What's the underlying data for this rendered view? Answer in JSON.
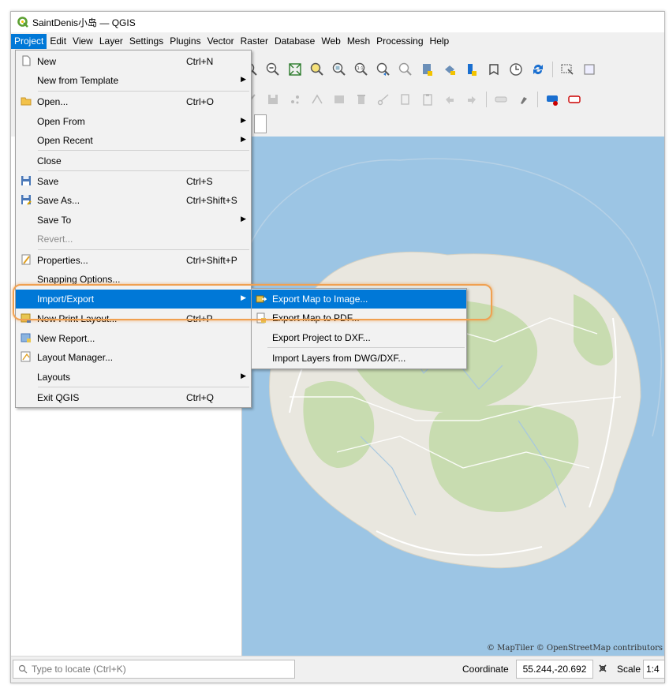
{
  "window": {
    "title": "SaintDenis小岛 — QGIS"
  },
  "menubar": [
    "Project",
    "Edit",
    "View",
    "Layer",
    "Settings",
    "Plugins",
    "Vector",
    "Raster",
    "Database",
    "Web",
    "Mesh",
    "Processing",
    "Help"
  ],
  "project_menu": {
    "new": {
      "label": "New",
      "shortcut": "Ctrl+N"
    },
    "new_from_template": {
      "label": "New from Template"
    },
    "open": {
      "label": "Open...",
      "shortcut": "Ctrl+O"
    },
    "open_from": {
      "label": "Open From"
    },
    "open_recent": {
      "label": "Open Recent"
    },
    "close": {
      "label": "Close"
    },
    "save": {
      "label": "Save",
      "shortcut": "Ctrl+S"
    },
    "save_as": {
      "label": "Save As...",
      "shortcut": "Ctrl+Shift+S"
    },
    "save_to": {
      "label": "Save To"
    },
    "revert": {
      "label": "Revert..."
    },
    "properties": {
      "label": "Properties...",
      "shortcut": "Ctrl+Shift+P"
    },
    "snapping_options": {
      "label": "Snapping Options..."
    },
    "import_export": {
      "label": "Import/Export"
    },
    "new_print_layout": {
      "label": "New Print Layout...",
      "shortcut": "Ctrl+P"
    },
    "new_report": {
      "label": "New Report..."
    },
    "layout_manager": {
      "label": "Layout Manager..."
    },
    "layouts": {
      "label": "Layouts"
    },
    "exit": {
      "label": "Exit QGIS",
      "shortcut": "Ctrl+Q"
    }
  },
  "import_export_submenu": {
    "export_image": "Export Map to Image...",
    "export_pdf": "Export Map to PDF...",
    "export_dxf": "Export Project to DXF...",
    "import_dwg": "Import Layers from DWG/DXF..."
  },
  "map": {
    "attribution": "© MapTiler  © OpenStreetMap contributors"
  },
  "status": {
    "locator_placeholder": "Type to locate (Ctrl+K)",
    "coordinate_label": "Coordinate",
    "coordinate_value": "55.244,-20.692",
    "scale_label": "Scale",
    "scale_value": "1:4"
  },
  "colors": {
    "accent": "#0078d7",
    "highlight_outline": "#f0a050",
    "sea": "#9cc5e4",
    "land": "#e9e7df",
    "forest": "#c8dcb0"
  },
  "icons": [
    "qgis-logo-icon",
    "new-file-icon",
    "open-folder-icon",
    "save-icon",
    "save-as-icon",
    "properties-icon",
    "new-print-layout-icon",
    "new-report-icon",
    "layout-manager-icon",
    "export-image-icon",
    "export-pdf-icon",
    "search-icon",
    "crs-icon"
  ]
}
